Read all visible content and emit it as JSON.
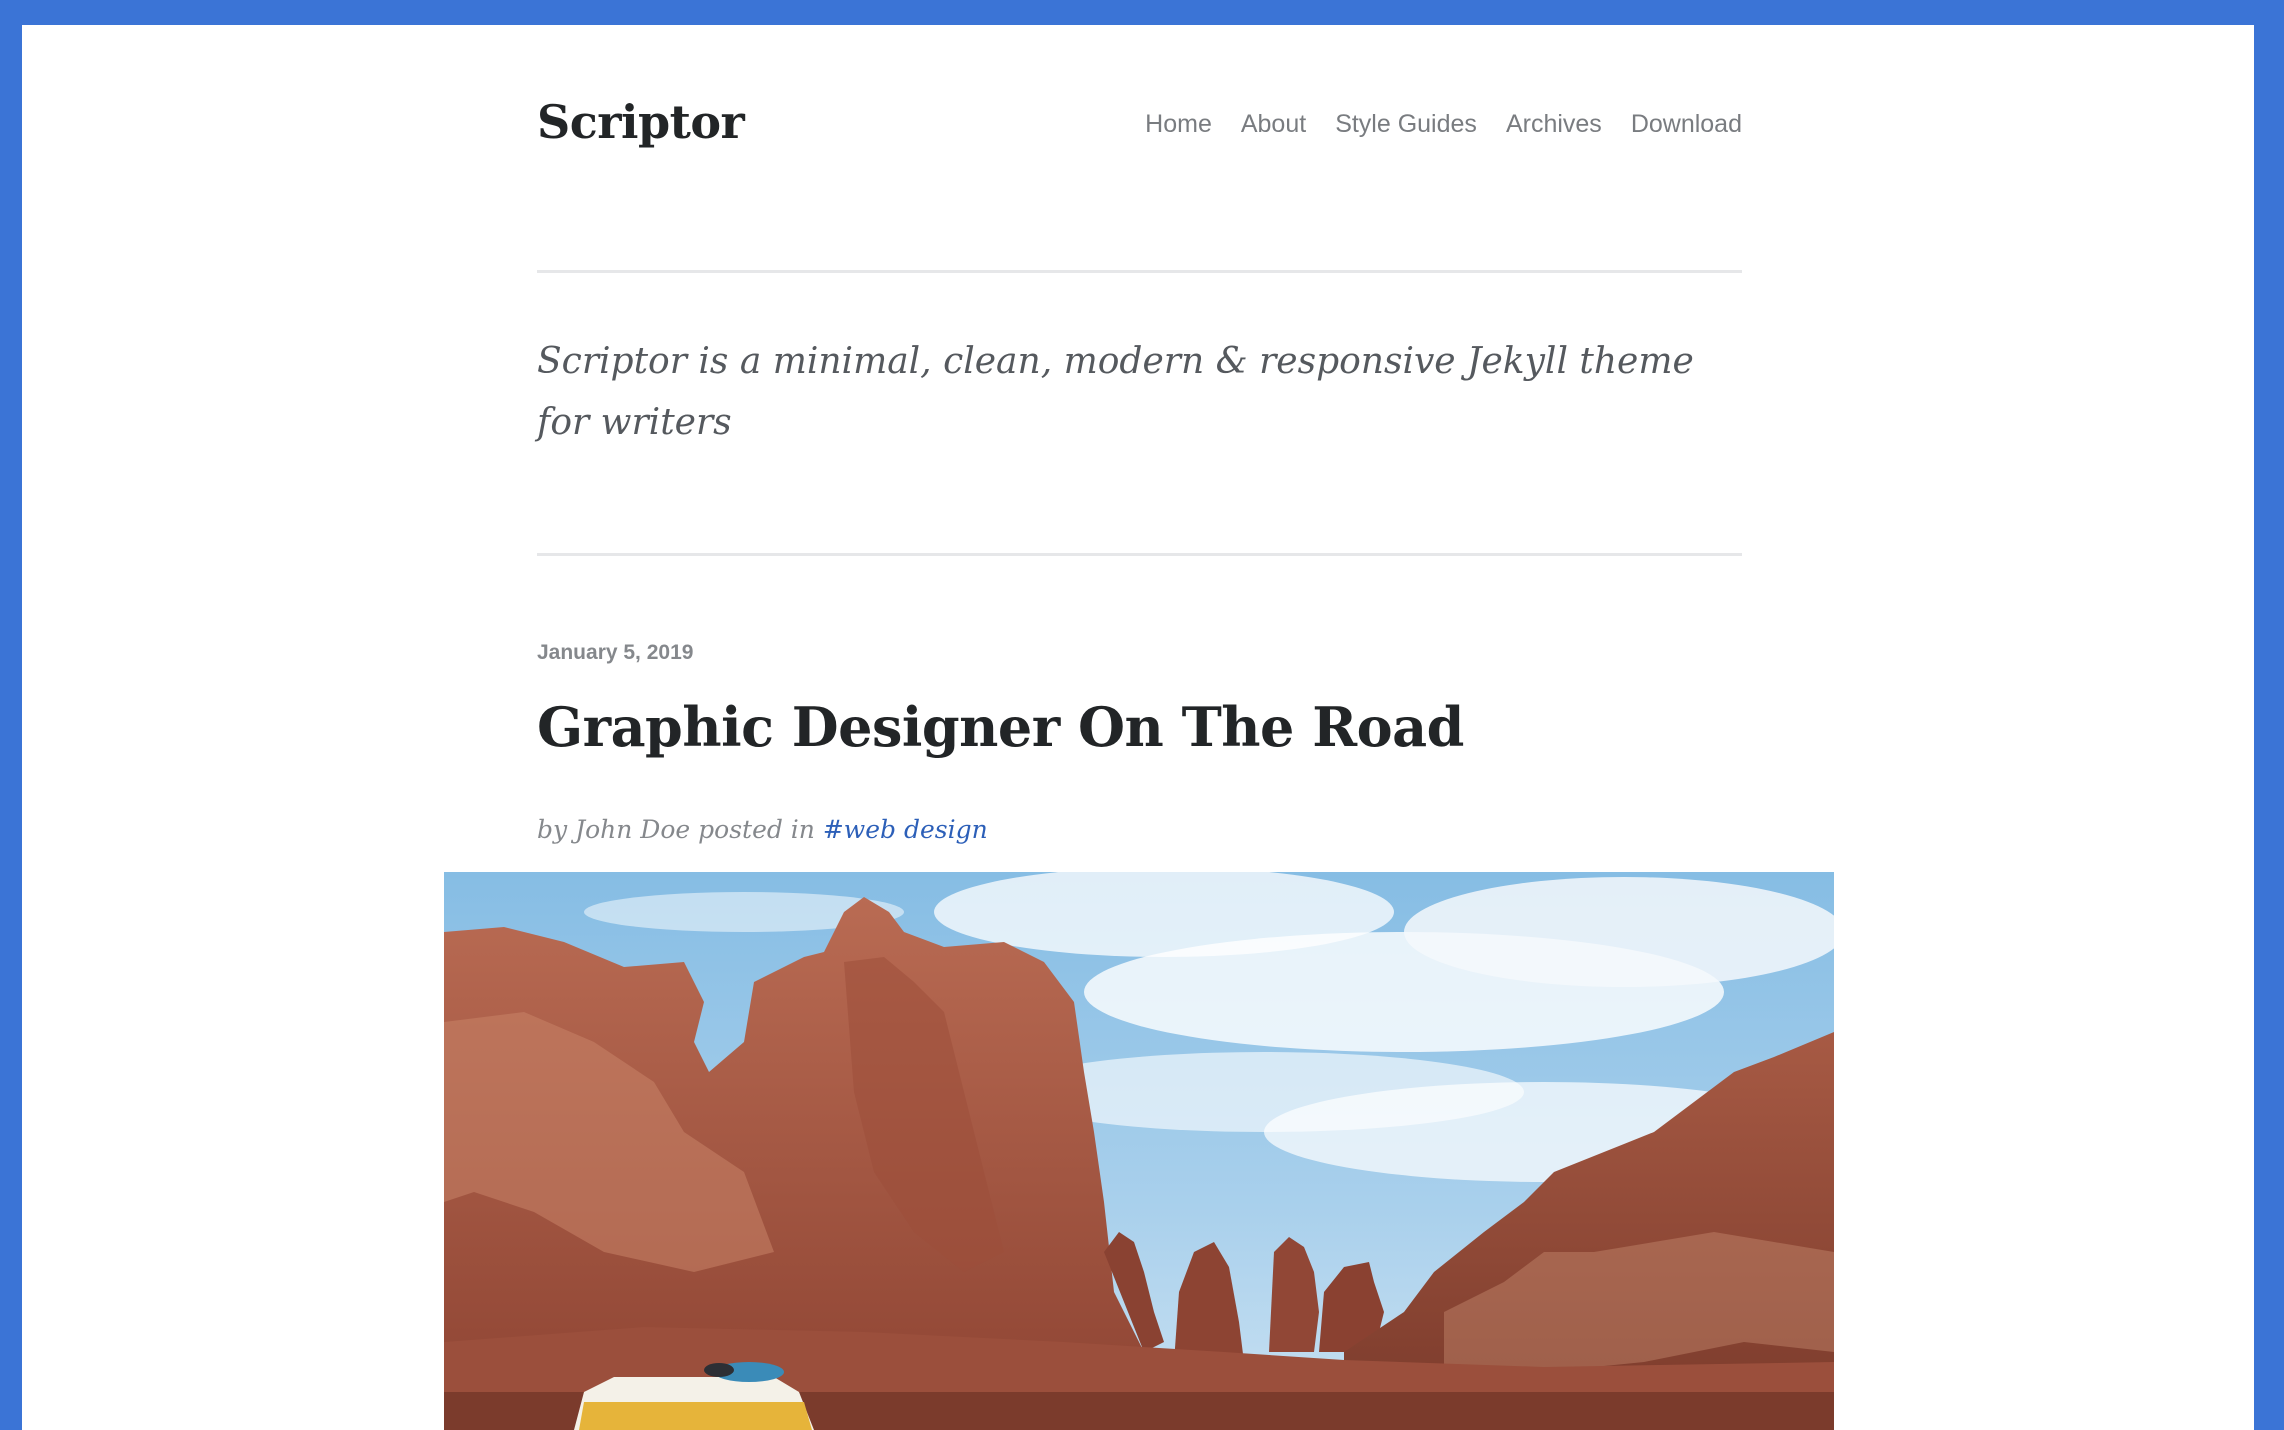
{
  "site": {
    "title": "Scriptor",
    "tagline": "Scriptor is a minimal, clean, modern & responsive Jekyll theme for writers"
  },
  "nav": {
    "items": [
      {
        "label": "Home"
      },
      {
        "label": "About"
      },
      {
        "label": "Style Guides"
      },
      {
        "label": "Archives"
      },
      {
        "label": "Download"
      }
    ]
  },
  "post": {
    "date": "January 5, 2019",
    "title": "Graphic Designer On The Road",
    "meta_prefix": "by John Doe posted in ",
    "tag": "#web design"
  },
  "colors": {
    "frame_border": "#3b74d6",
    "link": "#2c5fb8",
    "title": "#222527",
    "muted": "#85888c"
  }
}
